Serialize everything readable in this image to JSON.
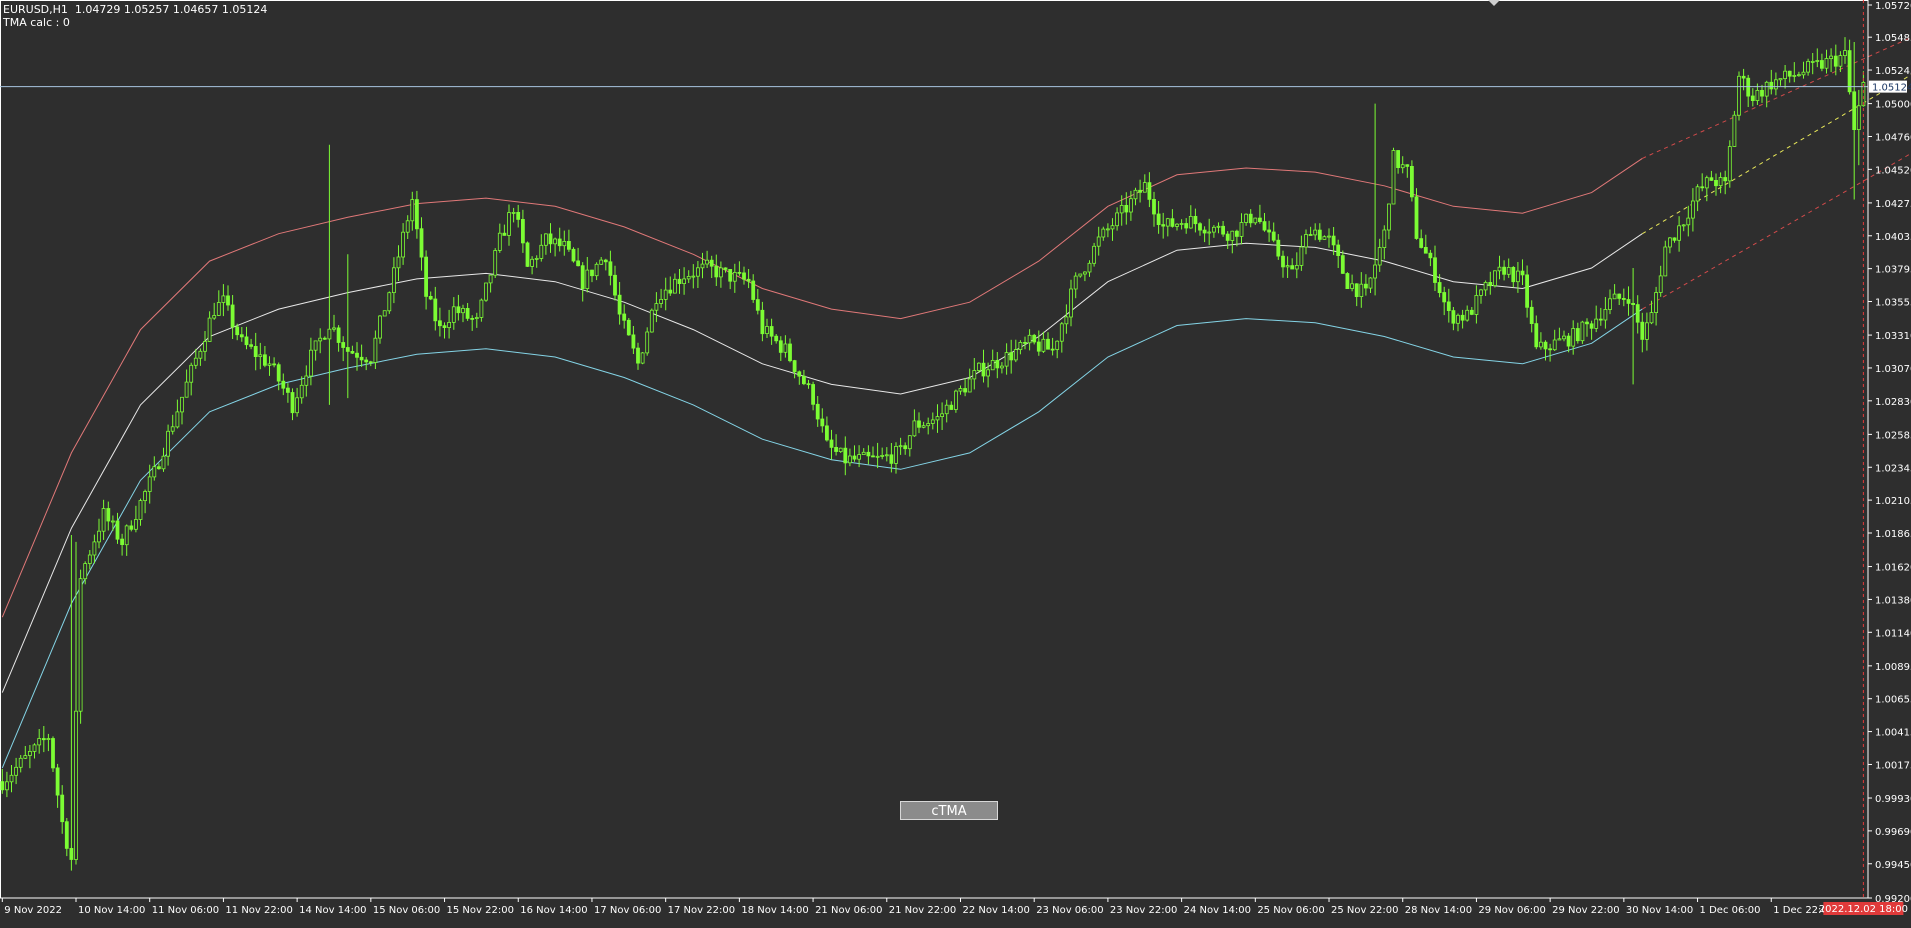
{
  "header": {
    "symbol_line": "EURUSD,H1  1.04729 1.05257 1.04657 1.05124",
    "indicator_line": "TMA calc : 0"
  },
  "button": {
    "label": "cTMA"
  },
  "colors": {
    "background": "#2e2e2e",
    "axis": "#ffffff",
    "candle": "#7cfc34",
    "upper_band": "#e07878",
    "mid_band": "#e8e8e8",
    "lower_band": "#84d4e6",
    "bid_line": "#a9c6e0",
    "projection_mid": "#e8e85a",
    "projection_edge": "#d04a4a",
    "time_marker": "#e03a3a"
  },
  "chart_data": {
    "type": "candlestick",
    "ylim": [
      0.992,
      1.0572
    ],
    "y_ticks": [
      "1.05720",
      "1.05485",
      "1.05245",
      "1.05000",
      "1.04760",
      "1.04520",
      "1.04275",
      "1.04035",
      "1.03795",
      "1.03555",
      "1.03310",
      "1.03070",
      "1.02830",
      "1.02585",
      "1.02345",
      "1.02105",
      "1.01865",
      "1.01620",
      "1.01380",
      "1.01140",
      "1.00895",
      "1.00655",
      "1.00415",
      "1.00175",
      "0.99930",
      "0.99690",
      "0.99450",
      "0.99200"
    ],
    "y_tick_values": [
      1.0572,
      1.05485,
      1.05245,
      1.05,
      1.0476,
      1.0452,
      1.04275,
      1.04035,
      1.03795,
      1.03555,
      1.0331,
      1.0307,
      1.0283,
      1.02585,
      1.02345,
      1.02105,
      1.01865,
      1.0162,
      1.0138,
      1.0114,
      1.00895,
      1.00655,
      1.00415,
      1.00175,
      0.9993,
      0.9969,
      0.9945,
      0.992
    ],
    "x_ticks": [
      "9 Nov 2022",
      "10 Nov 14:00",
      "11 Nov 06:00",
      "11 Nov 22:00",
      "14 Nov 14:00",
      "15 Nov 06:00",
      "15 Nov 22:00",
      "16 Nov 14:00",
      "17 Nov 06:00",
      "17 Nov 22:00",
      "18 Nov 14:00",
      "21 Nov 06:00",
      "21 Nov 22:00",
      "22 Nov 14:00",
      "23 Nov 06:00",
      "23 Nov 22:00",
      "24 Nov 14:00",
      "25 Nov 06:00",
      "25 Nov 22:00",
      "28 Nov 14:00",
      "29 Nov 06:00",
      "29 Nov 22:00",
      "30 Nov 14:00",
      "1 Dec 06:00",
      "1 Dec 22:00"
    ],
    "x_tick_bars": [
      0,
      16,
      32,
      48,
      64,
      80,
      96,
      112,
      128,
      144,
      160,
      176,
      192,
      208,
      224,
      240,
      256,
      272,
      288,
      304,
      320,
      336,
      352,
      368,
      384
    ],
    "current_price": "1.05124",
    "current_price_value": 1.05124,
    "current_time_label": "2022.12.02 18:00",
    "current_time_bar": 404,
    "bar_count": 405,
    "price_path": [
      [
        0,
        1.0005
      ],
      [
        10,
        1.0038
      ],
      [
        13,
        0.9975
      ],
      [
        15,
        0.9948
      ],
      [
        17,
        1.0155
      ],
      [
        22,
        1.02
      ],
      [
        26,
        1.018
      ],
      [
        33,
        1.023
      ],
      [
        40,
        1.0295
      ],
      [
        46,
        1.035
      ],
      [
        48,
        1.0355
      ],
      [
        52,
        1.0325
      ],
      [
        58,
        1.031
      ],
      [
        63,
        1.028
      ],
      [
        67,
        1.0315
      ],
      [
        71,
        1.034
      ],
      [
        75,
        1.032
      ],
      [
        80,
        1.0315
      ],
      [
        85,
        1.0375
      ],
      [
        89,
        1.043
      ],
      [
        92,
        1.036
      ],
      [
        95,
        1.0335
      ],
      [
        98,
        1.035
      ],
      [
        103,
        1.034
      ],
      [
        108,
        1.04
      ],
      [
        111,
        1.0425
      ],
      [
        114,
        1.038
      ],
      [
        118,
        1.04
      ],
      [
        122,
        1.0395
      ],
      [
        126,
        1.037
      ],
      [
        131,
        1.039
      ],
      [
        134,
        1.0345
      ],
      [
        138,
        1.031
      ],
      [
        142,
        1.036
      ],
      [
        148,
        1.0375
      ],
      [
        153,
        1.038
      ],
      [
        157,
        1.0375
      ],
      [
        162,
        1.037
      ],
      [
        165,
        1.0335
      ],
      [
        170,
        1.032
      ],
      [
        176,
        1.0285
      ],
      [
        179,
        1.025
      ],
      [
        183,
        1.024
      ],
      [
        190,
        1.024
      ],
      [
        195,
        1.0245
      ],
      [
        198,
        1.0265
      ],
      [
        203,
        1.027
      ],
      [
        208,
        1.029
      ],
      [
        212,
        1.0305
      ],
      [
        218,
        1.0315
      ],
      [
        223,
        1.0325
      ],
      [
        228,
        1.032
      ],
      [
        233,
        1.037
      ],
      [
        238,
        1.04
      ],
      [
        243,
        1.042
      ],
      [
        248,
        1.044
      ],
      [
        252,
        1.041
      ],
      [
        257,
        1.0415
      ],
      [
        262,
        1.041
      ],
      [
        267,
        1.0405
      ],
      [
        272,
        1.042
      ],
      [
        276,
        1.0395
      ],
      [
        280,
        1.0375
      ],
      [
        284,
        1.041
      ],
      [
        288,
        1.04
      ],
      [
        292,
        1.037
      ],
      [
        296,
        1.036
      ],
      [
        300,
        1.0405
      ],
      [
        302,
        1.046
      ],
      [
        305,
        1.045
      ],
      [
        307,
        1.0405
      ],
      [
        311,
        1.0375
      ],
      [
        314,
        1.0345
      ],
      [
        318,
        1.0345
      ],
      [
        322,
        1.0365
      ],
      [
        326,
        1.038
      ],
      [
        330,
        1.037
      ],
      [
        333,
        1.032
      ],
      [
        337,
        1.0325
      ],
      [
        341,
        1.033
      ],
      [
        345,
        1.034
      ],
      [
        349,
        1.0355
      ],
      [
        353,
        1.036
      ],
      [
        356,
        1.033
      ],
      [
        358,
        1.0345
      ],
      [
        361,
        1.0395
      ],
      [
        365,
        1.0415
      ],
      [
        368,
        1.0435
      ],
      [
        371,
        1.0445
      ],
      [
        374,
        1.044
      ],
      [
        377,
        1.052
      ],
      [
        380,
        1.0505
      ],
      [
        384,
        1.0515
      ],
      [
        388,
        1.052
      ],
      [
        392,
        1.0525
      ],
      [
        396,
        1.053
      ],
      [
        400,
        1.0535
      ],
      [
        402,
        1.048
      ],
      [
        404,
        1.05124
      ]
    ],
    "tma_mid": [
      [
        0,
        1.007
      ],
      [
        15,
        1.019
      ],
      [
        30,
        1.028
      ],
      [
        45,
        1.033
      ],
      [
        60,
        1.035
      ],
      [
        75,
        1.0362
      ],
      [
        90,
        1.0372
      ],
      [
        105,
        1.0376
      ],
      [
        120,
        1.037
      ],
      [
        135,
        1.0355
      ],
      [
        150,
        1.0335
      ],
      [
        165,
        1.031
      ],
      [
        180,
        1.0295
      ],
      [
        195,
        1.0288
      ],
      [
        210,
        1.03
      ],
      [
        225,
        1.033
      ],
      [
        240,
        1.037
      ],
      [
        255,
        1.0393
      ],
      [
        270,
        1.0398
      ],
      [
        285,
        1.0395
      ],
      [
        300,
        1.0385
      ],
      [
        315,
        1.037
      ],
      [
        330,
        1.0365
      ],
      [
        345,
        1.038
      ],
      [
        356,
        1.0405
      ]
    ],
    "tma_upper": [
      [
        0,
        1.0125
      ],
      [
        15,
        1.0245
      ],
      [
        30,
        1.0335
      ],
      [
        45,
        1.0385
      ],
      [
        60,
        1.0405
      ],
      [
        75,
        1.0417
      ],
      [
        90,
        1.0427
      ],
      [
        105,
        1.0431
      ],
      [
        120,
        1.0425
      ],
      [
        135,
        1.041
      ],
      [
        150,
        1.039
      ],
      [
        165,
        1.0365
      ],
      [
        180,
        1.035
      ],
      [
        195,
        1.0343
      ],
      [
        210,
        1.0355
      ],
      [
        225,
        1.0385
      ],
      [
        240,
        1.0425
      ],
      [
        255,
        1.0448
      ],
      [
        270,
        1.0453
      ],
      [
        285,
        1.045
      ],
      [
        300,
        1.044
      ],
      [
        315,
        1.0425
      ],
      [
        330,
        1.042
      ],
      [
        345,
        1.0435
      ],
      [
        356,
        1.046
      ]
    ],
    "tma_lower": [
      [
        0,
        1.0015
      ],
      [
        15,
        1.0135
      ],
      [
        30,
        1.0225
      ],
      [
        45,
        1.0275
      ],
      [
        60,
        1.0295
      ],
      [
        75,
        1.0307
      ],
      [
        90,
        1.0317
      ],
      [
        105,
        1.0321
      ],
      [
        120,
        1.0315
      ],
      [
        135,
        1.03
      ],
      [
        150,
        1.028
      ],
      [
        165,
        1.0255
      ],
      [
        180,
        1.024
      ],
      [
        195,
        1.0233
      ],
      [
        210,
        1.0245
      ],
      [
        225,
        1.0275
      ],
      [
        240,
        1.0315
      ],
      [
        255,
        1.0338
      ],
      [
        270,
        1.0343
      ],
      [
        285,
        1.034
      ],
      [
        300,
        1.033
      ],
      [
        315,
        1.0315
      ],
      [
        330,
        1.031
      ],
      [
        345,
        1.0325
      ],
      [
        356,
        1.035
      ]
    ],
    "projection_mid": [
      [
        356,
        1.0405
      ],
      [
        440,
        1.0572
      ]
    ],
    "projection_upper": [
      [
        356,
        1.046
      ],
      [
        430,
        1.0572
      ]
    ],
    "projection_lower": [
      [
        356,
        1.035
      ],
      [
        470,
        1.0572
      ]
    ]
  }
}
